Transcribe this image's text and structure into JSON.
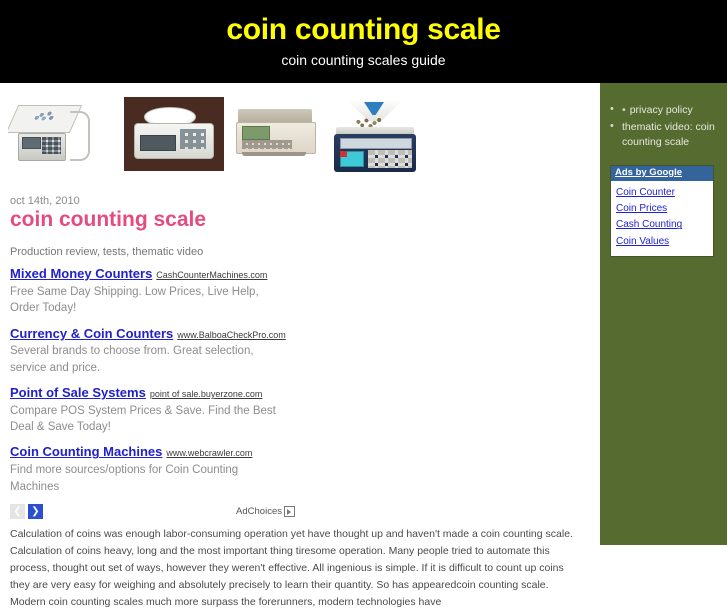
{
  "header": {
    "title": "coin counting scale",
    "subtitle": "coin counting scales guide",
    "title_color": "#ffff00",
    "background_color": "#000000"
  },
  "gallery": {
    "items": [
      {
        "name": "platform-coin-scale"
      },
      {
        "name": "round-pan-precision-balance"
      },
      {
        "name": "retail-counting-scale"
      },
      {
        "name": "blue-coin-counting-scale-with-funnel"
      }
    ]
  },
  "article": {
    "date": "oct 14th, 2010",
    "title": "coin counting scale",
    "title_color": "#e54b7c",
    "body": "Calculation of coins was enough labor-consuming operation yet have thought up and haven't made a coin counting scale. Calculation of coins heavy, long and the most important thing tiresome operation. Many people tried to automate this process, thought out set of ways, however they weren't effective. All ingenious is simple. If it is difficult to count up coins they are very easy for weighing and absolutely precisely to learn their quantity. So has appearedcoin counting scale. Modern coin counting scales much more surpass the forerunners, modern technologies have"
  },
  "ads": {
    "heading": "Production review, tests, thematic video",
    "units": [
      {
        "title": "Mixed Money Counters",
        "url": "CashCounterMachines.com",
        "description": "Free Same Day Shipping. Low Prices, Live Help, Order Today!"
      },
      {
        "title": "Currency & Coin Counters",
        "url": "www.BalboaCheckPro.com",
        "description": "Several brands to choose from. Great selection, service and price."
      },
      {
        "title": "Point of Sale Systems",
        "url": "point of sale.buyerzone.com",
        "description": "Compare POS System Prices & Save. Find the Best Deal & Save Today!"
      },
      {
        "title": "Coin Counting Machines",
        "url": "www.webcrawler.com",
        "description": "Find more sources/options for Coin Counting Machines"
      }
    ],
    "pager": {
      "prev_label": "❮",
      "next_label": "❯"
    },
    "adchoices_label": "AdChoices"
  },
  "sidebar": {
    "background_color": "#566b30",
    "links": [
      {
        "label": "privacy policy",
        "nested_bullet": true
      },
      {
        "label": "thematic video: coin counting scale",
        "nested_bullet": false
      }
    ],
    "ads_box": {
      "header": "Ads by Google",
      "header_color": "#33649c",
      "links": [
        "Coin Counter",
        "Coin Prices",
        "Cash Counting",
        "Coin Values"
      ]
    }
  }
}
